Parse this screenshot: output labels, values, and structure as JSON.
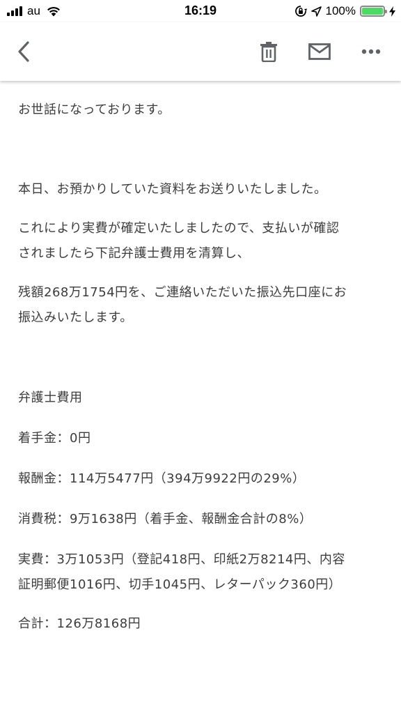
{
  "status_bar": {
    "carrier": "au",
    "time": "16:19",
    "battery_percent_label": "100%",
    "battery_level": 1.0
  },
  "toolbar": {
    "icons": [
      "back-arrow-icon",
      "trash-icon",
      "mail-icon",
      "more-horizontal-icon"
    ]
  },
  "email": {
    "paragraphs": [
      "お世話になっております。",
      "本日、お預かりしていた資料をお送りいたしました。",
      "これにより実費が確定いたしましたので、支払いが確認\nされましたら下記弁護士費用を清算し、",
      "残額268万1754円を、ご連絡いただいた振込先口座にお\n振込みいたします。",
      "弁護士費用",
      "着手金：0円",
      "報酬金：114万5477円（394万9922円の29%）",
      "消費税：9万1638円（着手金、報酬金合計の8%）",
      "実費：3万1053円（登記418円、印紙2万8214円、内容\n証明郵便1016円、切手1045円、レターパック360円）",
      "合計：126万8168円"
    ]
  },
  "colors": {
    "battery_green": "#4cd964",
    "text": "#3c3c3c",
    "icon": "#5f6368"
  }
}
